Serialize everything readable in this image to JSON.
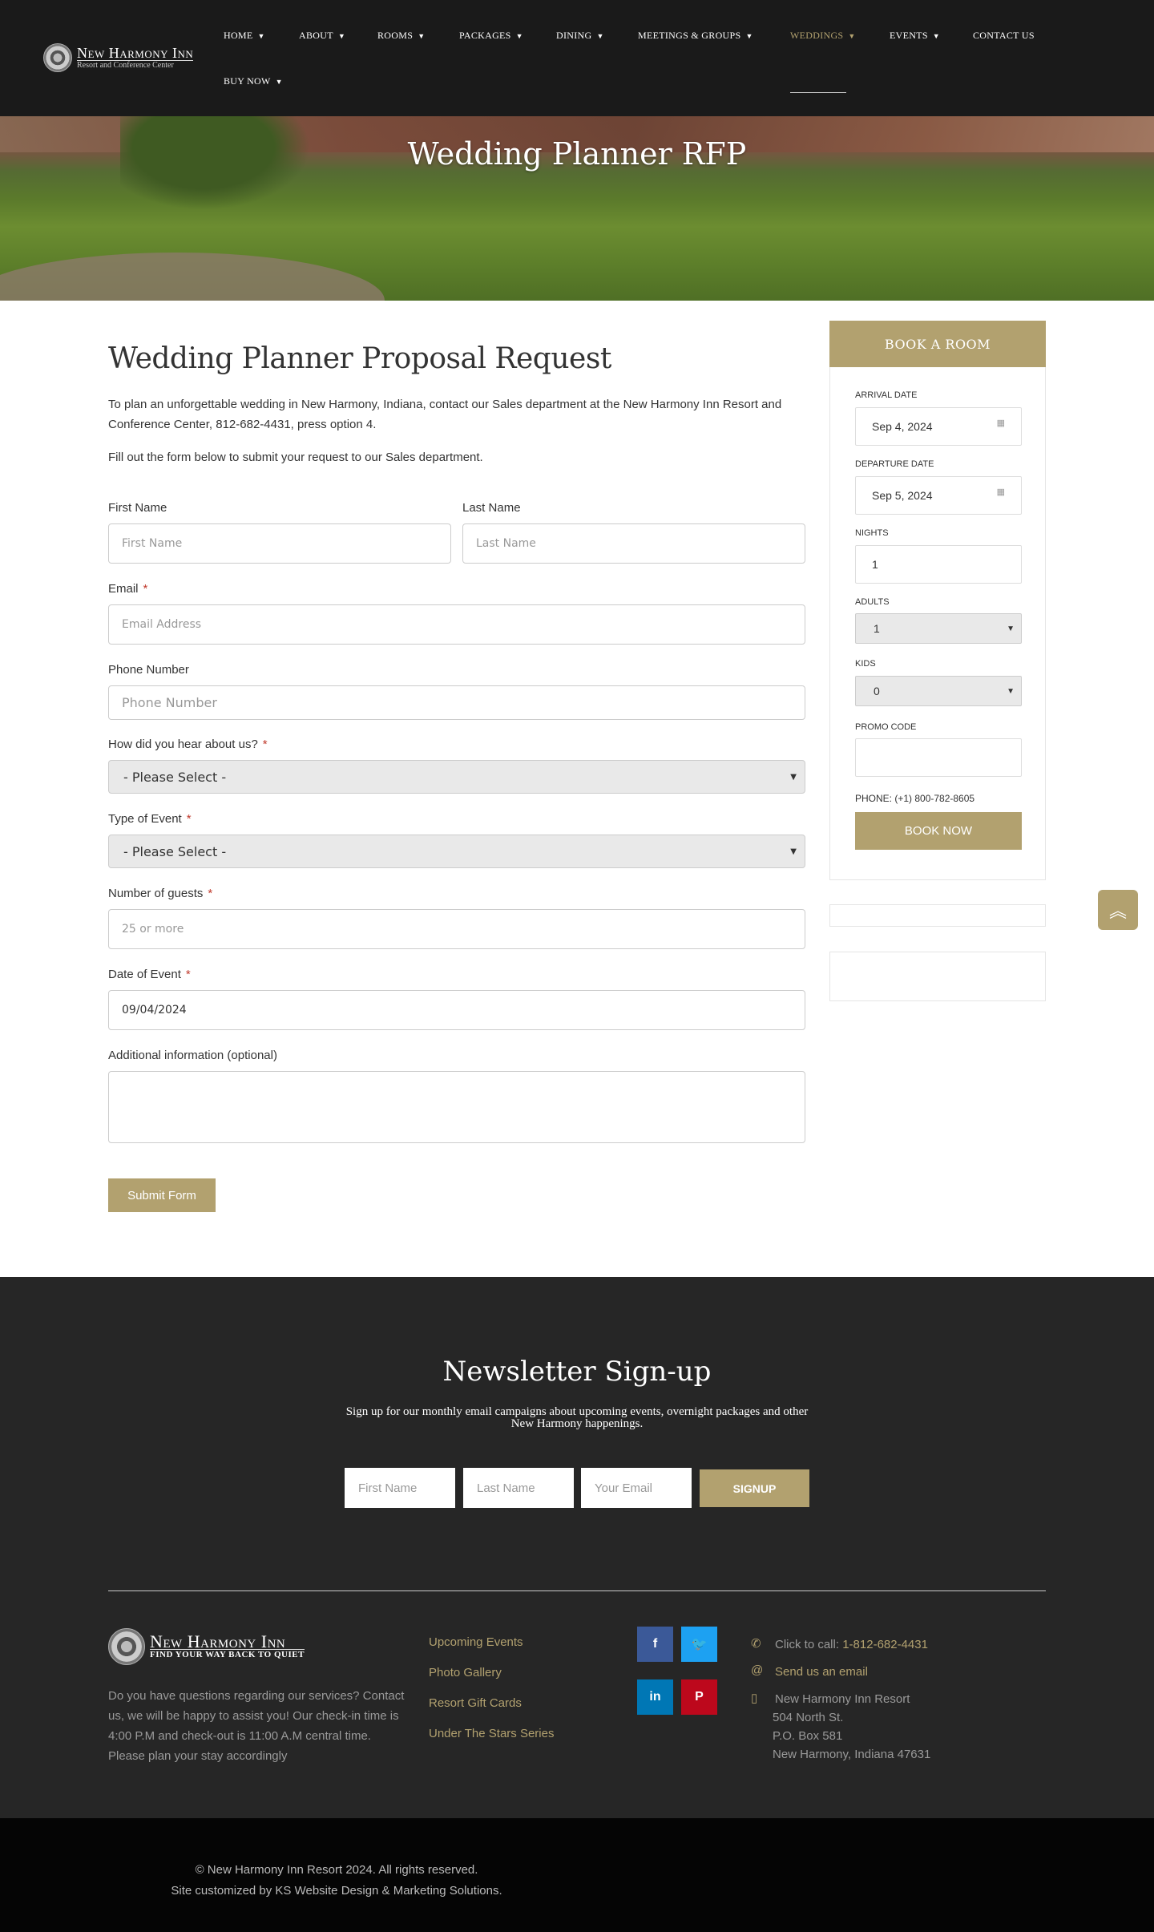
{
  "header": {
    "logo": {
      "name": "New Harmony Inn",
      "tagline": "Resort and Conference Center"
    },
    "nav": [
      {
        "label": "Home",
        "has_dropdown": true
      },
      {
        "label": "About",
        "has_dropdown": true
      },
      {
        "label": "Rooms",
        "has_dropdown": true
      },
      {
        "label": "Packages",
        "has_dropdown": true
      },
      {
        "label": "Dining",
        "has_dropdown": true
      },
      {
        "label": "Meetings & Groups",
        "has_dropdown": true
      },
      {
        "label": "Weddings",
        "has_dropdown": true,
        "active": true
      },
      {
        "label": "Events",
        "has_dropdown": true
      },
      {
        "label": "Contact Us",
        "has_dropdown": false
      },
      {
        "label": "Buy Now",
        "has_dropdown": true
      }
    ]
  },
  "hero": {
    "title": "Wedding Planner RFP"
  },
  "main": {
    "title": "Wedding Planner Proposal Request",
    "intro": "To plan an unforgettable wedding in New Harmony, Indiana, contact our Sales department at the New Harmony Inn Resort and Conference Center, 812-682-4431, press option 4.",
    "intro2": "Fill out the form below to submit your request to our Sales department.",
    "form": {
      "first_name": {
        "label": "First Name",
        "placeholder": "First Name"
      },
      "last_name": {
        "label": "Last Name",
        "placeholder": "Last Name"
      },
      "email": {
        "label": "Email",
        "required": "*",
        "placeholder": "Email Address"
      },
      "phone": {
        "label": "Phone Number",
        "placeholder": "Phone Number"
      },
      "hear_about": {
        "label": "How did you hear about us?",
        "required": "*",
        "selected": "- Please Select -"
      },
      "event_type": {
        "label": "Type of Event",
        "required": "*",
        "selected": "- Please Select -"
      },
      "guests": {
        "label": "Number of guests",
        "required": "*",
        "placeholder": "25 or more"
      },
      "event_date": {
        "label": "Date of Event",
        "required": "*",
        "value": "09/04/2024"
      },
      "additional": {
        "label": "Additional information (optional)",
        "value": ""
      },
      "submit_label": "Submit Form"
    }
  },
  "booking": {
    "title": "BOOK A ROOM",
    "arrival": {
      "label": "Arrival Date",
      "value": "Sep 4, 2024"
    },
    "departure": {
      "label": "Departure Date",
      "value": "Sep 5, 2024"
    },
    "nights": {
      "label": "Nights",
      "value": "1"
    },
    "adults": {
      "label": "Adults",
      "selected": "1"
    },
    "kids": {
      "label": "Kids",
      "selected": "0"
    },
    "promo": {
      "label": "Promo Code",
      "value": ""
    },
    "phone": "PHONE: (+1) 800-782-8605",
    "book_label": "BOOK NOW"
  },
  "scroll_top_icon": "double-chevron-up",
  "newsletter": {
    "title": "Newsletter Sign-up",
    "subtitle": "Sign up for our monthly email campaigns about upcoming events, overnight packages and other New Harmony happenings.",
    "first_placeholder": "First Name",
    "last_placeholder": "Last Name",
    "email_placeholder": "Your Email",
    "signup_label": "SIGNUP"
  },
  "footer": {
    "logo": {
      "name": "New Harmony Inn",
      "tagline": "FIND YOUR WAY BACK TO QUIET"
    },
    "about": "Do you have questions regarding our services? Contact us, we will be happy to assist you! Our check-in time is 4:00 P.M and check-out is 11:00 A.M central time. Please plan your stay accordingly",
    "links": [
      "Upcoming Events",
      "Photo Gallery",
      "Resort Gift Cards",
      "Under The Stars Series"
    ],
    "social": [
      {
        "name": "facebook",
        "glyph": "f",
        "color": "#3b5998"
      },
      {
        "name": "twitter",
        "glyph": "🐦",
        "color": "#1da1f2"
      },
      {
        "name": "linkedin",
        "glyph": "in",
        "color": "#0077b5"
      },
      {
        "name": "pinterest",
        "glyph": "P",
        "color": "#bd081c"
      }
    ],
    "contact": {
      "call_prefix": "Click to call:",
      "call_number": "1-812-682-4431",
      "email_label": "Send us an email",
      "address_lines": [
        "New Harmony Inn Resort",
        "504 North St.",
        "P.O. Box 581",
        "New Harmony, Indiana 47631"
      ]
    },
    "copyright": "© New Harmony Inn Resort 2024. All rights reserved.",
    "credit": "Site customized by KS Website Design & Marketing Solutions."
  },
  "colors": {
    "accent": "#b2a16f",
    "header_bg": "#1a1a1a",
    "footer_bg": "#262626",
    "bottom_bg": "#050505"
  }
}
